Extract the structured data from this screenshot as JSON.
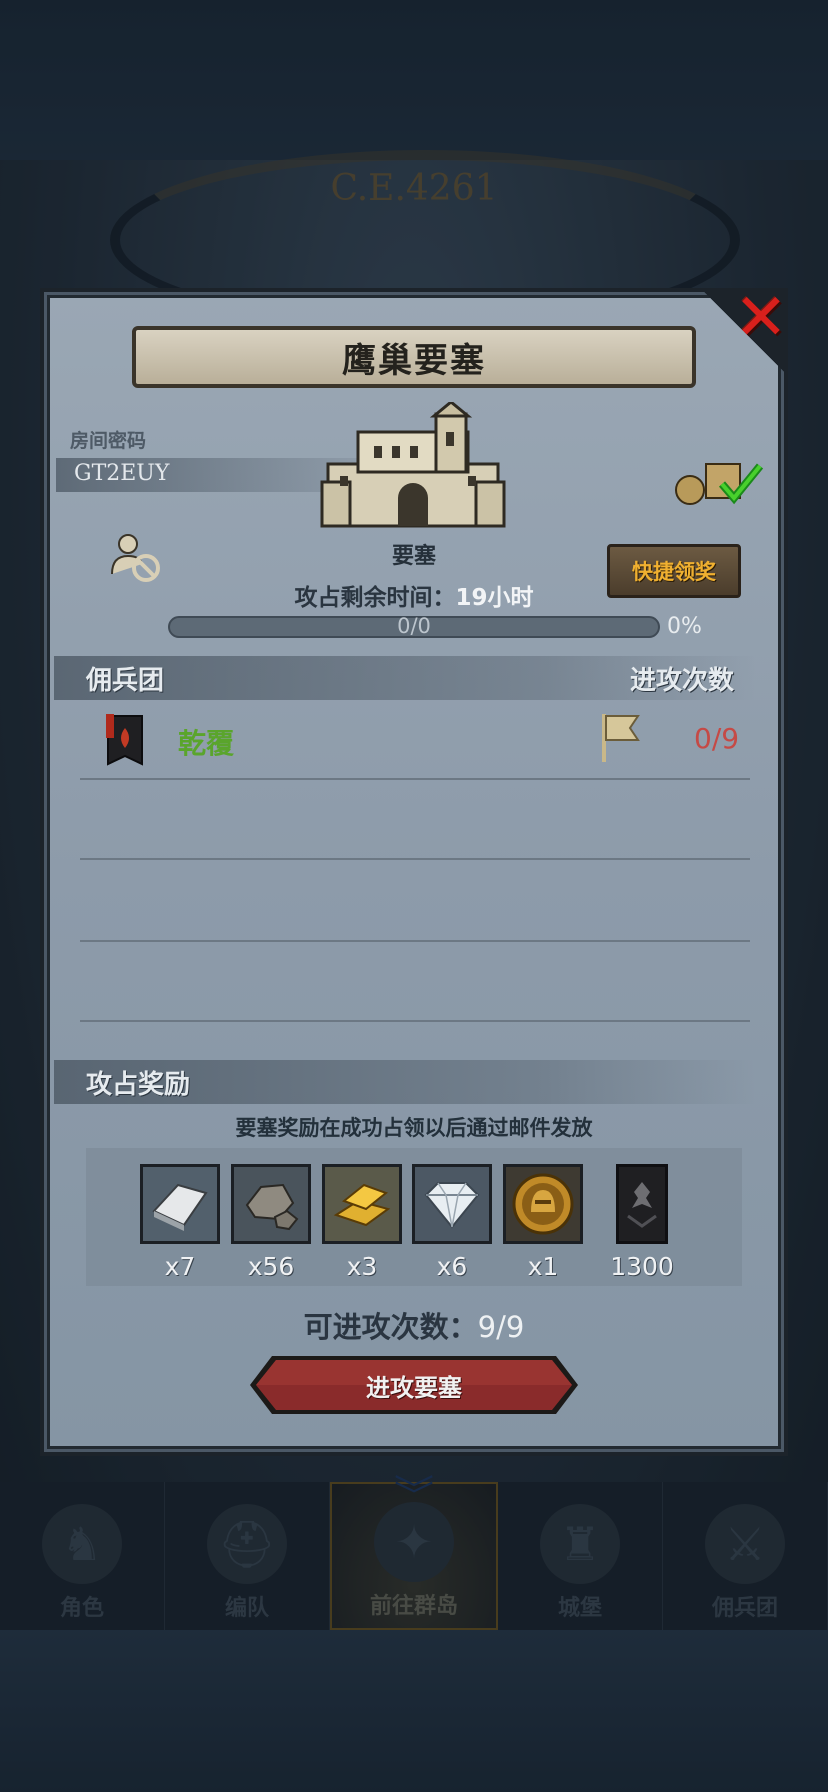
{
  "background": {
    "era_text": "C.E.4261"
  },
  "bottom_nav": [
    {
      "label": "角色",
      "icon": "knight-icon",
      "active": false
    },
    {
      "label": "编队",
      "icon": "helmet-icon",
      "active": false
    },
    {
      "label": "前往群岛",
      "icon": "compass-icon",
      "active": true
    },
    {
      "label": "城堡",
      "icon": "castle-icon",
      "active": false
    },
    {
      "label": "佣兵团",
      "icon": "mercenary-icon",
      "active": false
    }
  ],
  "dialog": {
    "title": "鹰巢要塞",
    "room_label": "房间密码",
    "room_code": "GT2EUY",
    "building_label": "要塞",
    "quick_claim_label": "快捷领奖",
    "time_label": "攻占剩余时间：",
    "time_value": "19小时",
    "progress_text": "0/0",
    "progress_fraction": 0,
    "progress_percent": "0%",
    "mercenary_header": "佣兵团",
    "attack_count_header": "进攻次数",
    "guild": {
      "name": "乾覆",
      "attacks": "0/9"
    },
    "rewards_header": "攻占奖励",
    "rewards_note": "要塞奖励在成功占领以后通过邮件发放",
    "rewards": [
      {
        "item": "silver-ingot-icon",
        "qty": "x7"
      },
      {
        "item": "ore-icon",
        "qty": "x56"
      },
      {
        "item": "gold-bar-icon",
        "qty": "x3"
      },
      {
        "item": "diamond-icon",
        "qty": "x6"
      },
      {
        "item": "medal-icon",
        "qty": "x1"
      },
      {
        "item": "banner-icon",
        "qty": "1300"
      }
    ],
    "available_label": "可进攻次数：",
    "available_value": "9/9",
    "attack_button": "进攻要塞"
  },
  "colors": {
    "guild_name": "#5aa52c",
    "attack_count": "#c54a46",
    "quick_claim_text": "#f0b030",
    "close_x": "#d8201c",
    "attack_button": "#8a2b2b"
  }
}
